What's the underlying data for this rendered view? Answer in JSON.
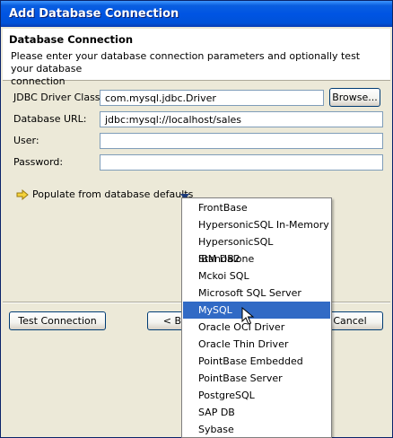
{
  "window": {
    "title": "Add Database Connection"
  },
  "header": {
    "title": "Database Connection",
    "description_line1": "Please enter your database connection parameters and optionally test your database",
    "description_line2": "connection"
  },
  "form": {
    "driver_label": "JDBC Driver Class:",
    "driver_value": "com.mysql.jdbc.Driver",
    "browse_label": "Browse...",
    "url_label": "Database URL:",
    "url_value": "jdbc:mysql://localhost/sales",
    "user_label": "User:",
    "user_value": "",
    "password_label": "Password:",
    "password_value": ""
  },
  "populate": {
    "label": "Populate from database defaults"
  },
  "dropdown": {
    "items": [
      "FrontBase",
      "HypersonicSQL In-Memory",
      "HypersonicSQL Standalone",
      "IBM DB2",
      "Mckoi SQL",
      "Microsoft SQL Server",
      "MySQL",
      "Oracle OCI Driver",
      "Oracle Thin Driver",
      "PointBase Embedded",
      "PointBase Server",
      "PostgreSQL",
      "SAP DB",
      "Sybase"
    ],
    "selected": "MySQL"
  },
  "buttons": {
    "test_connection": "Test Connection",
    "back": "< Back",
    "cancel": "Cancel"
  },
  "colors": {
    "title_bar": "#0054e3",
    "selection": "#316ac5",
    "dialog_bg": "#ece9d8"
  },
  "icons": {
    "populate": "arrow-right-icon",
    "expand": "triangle-down-icon",
    "cursor": "mouse-pointer-icon"
  }
}
